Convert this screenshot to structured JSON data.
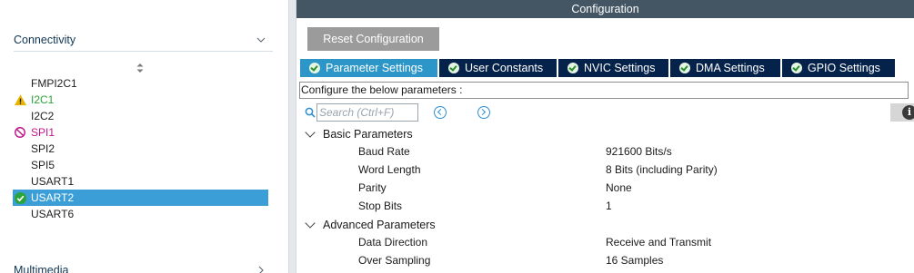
{
  "sidebar": {
    "categories": {
      "connectivity": "Connectivity",
      "multimedia": "Multimedia"
    },
    "items": [
      {
        "label": "FMPI2C1",
        "status": "none"
      },
      {
        "label": "I2C1",
        "status": "warning"
      },
      {
        "label": "I2C2",
        "status": "none"
      },
      {
        "label": "SPI1",
        "status": "error"
      },
      {
        "label": "SPI2",
        "status": "none"
      },
      {
        "label": "SPI5",
        "status": "none"
      },
      {
        "label": "USART1",
        "status": "none"
      },
      {
        "label": "USART2",
        "status": "ok",
        "selected": true
      },
      {
        "label": "USART6",
        "status": "none"
      }
    ]
  },
  "config": {
    "title": "Configuration",
    "reset_label": "Reset Configuration",
    "tabs": [
      {
        "label": "Parameter Settings",
        "active": true
      },
      {
        "label": "User Constants",
        "active": false
      },
      {
        "label": "NVIC Settings",
        "active": false
      },
      {
        "label": "DMA Settings",
        "active": false
      },
      {
        "label": "GPIO Settings",
        "active": false
      }
    ],
    "info": "Configure the below parameters :",
    "search_placeholder": "Search (Ctrl+F)",
    "groups": {
      "basic": {
        "label": "Basic Parameters",
        "params": [
          {
            "name": "Baud Rate",
            "value": "921600 Bits/s"
          },
          {
            "name": "Word Length",
            "value": "8 Bits (including Parity)"
          },
          {
            "name": "Parity",
            "value": "None"
          },
          {
            "name": "Stop Bits",
            "value": "1"
          }
        ]
      },
      "advanced": {
        "label": "Advanced Parameters",
        "params": [
          {
            "name": "Data Direction",
            "value": "Receive and Transmit"
          },
          {
            "name": "Over Sampling",
            "value": "16 Samples"
          }
        ]
      }
    }
  },
  "colors": {
    "header_bg": "#445563",
    "tab_bar_bg": "#05224a",
    "tab_active_bg": "#2c96c9",
    "selected_row_bg": "#3c9ed6",
    "reset_button_bg": "#9b9b9b",
    "warning": "#e8b400",
    "error": "#c0168c",
    "ok": "#2aa33a"
  }
}
